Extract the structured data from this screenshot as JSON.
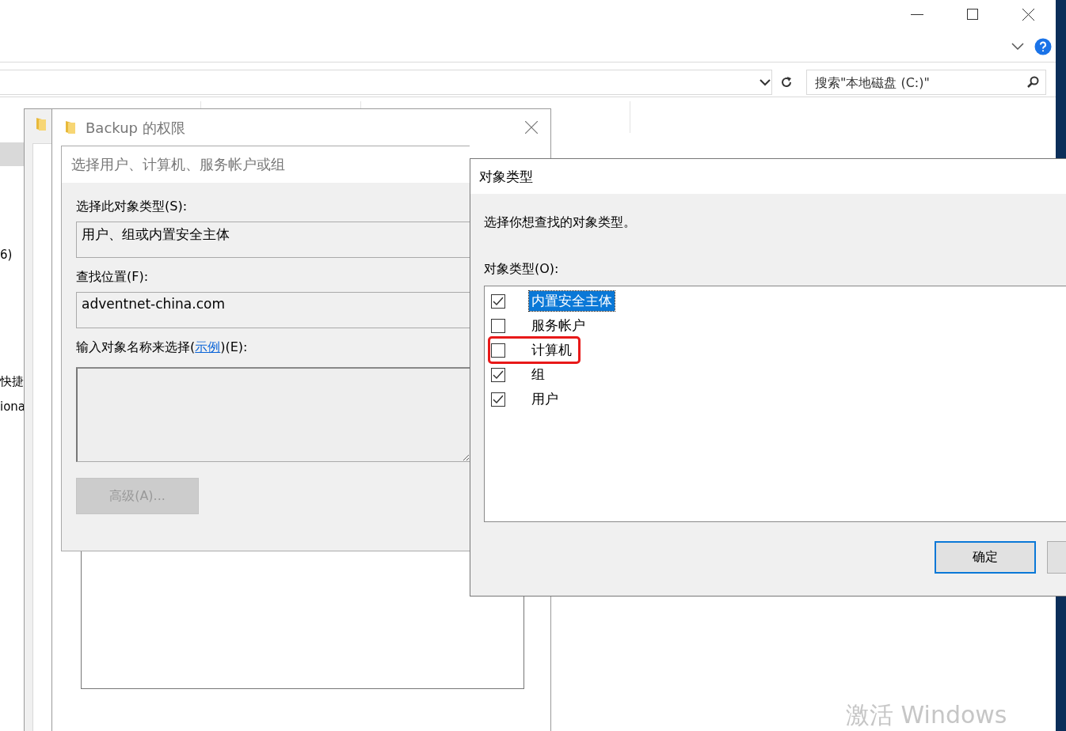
{
  "explorer": {
    "search": {
      "placeholder": "搜索\"本地磁盘 (C:)\""
    },
    "fragments": [
      "6)",
      "快捷",
      "iona"
    ],
    "activation_text": "激活 Windows"
  },
  "permissions_window": {
    "title": "Backup 的权限"
  },
  "select_dialog": {
    "title": "选择用户、计算机、服务帐户或组",
    "object_type_label": "选择此对象类型(S):",
    "object_type_value": "用户、组或内置安全主体",
    "location_label": "查找位置(F):",
    "location_value": "adventnet-china.com",
    "names_label": {
      "prefix": "输入对象名称来选择(",
      "link": "示例",
      "suffix": ")(E):"
    },
    "advanced_button": {
      "label": "高级(A)...",
      "disabled": true
    }
  },
  "object_types_dialog": {
    "title": "对象类型",
    "description": "选择你想查找的对象类型。",
    "list_label": "对象类型(O):",
    "items": [
      {
        "label": "内置安全主体",
        "checked": true,
        "selected": true,
        "highlighted": false
      },
      {
        "label": "服务帐户",
        "checked": false,
        "selected": false,
        "highlighted": false
      },
      {
        "label": "计算机",
        "checked": false,
        "selected": false,
        "highlighted": true
      },
      {
        "label": "组",
        "checked": true,
        "selected": false,
        "highlighted": false
      },
      {
        "label": "用户",
        "checked": true,
        "selected": false,
        "highlighted": false
      }
    ],
    "ok_button": "确定"
  }
}
